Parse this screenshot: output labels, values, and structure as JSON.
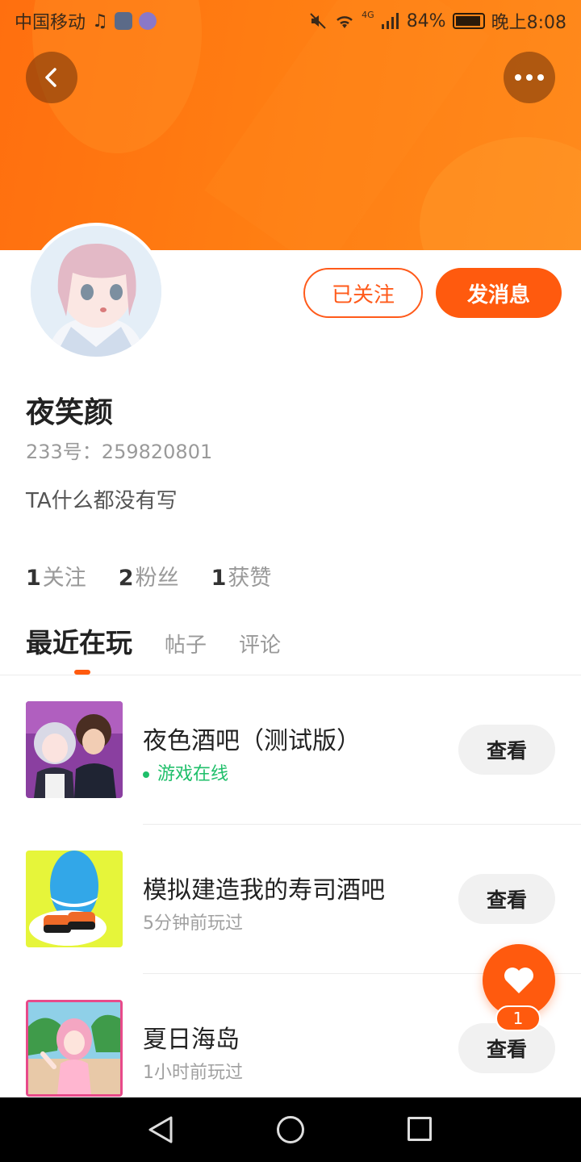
{
  "status_bar": {
    "carrier": "中国移动",
    "network": "4G",
    "battery": "84%",
    "time": "晚上8:08"
  },
  "header": {
    "back_icon": "chevron-left-icon",
    "more_icon": "more-horizontal-icon",
    "accent_color": "#ff6f0f"
  },
  "profile": {
    "follow_button_label": "已关注",
    "message_button_label": "发消息",
    "name": "夜笑颜",
    "id_line": "233号：259820801",
    "bio": "TA什么都没有写",
    "stats": [
      {
        "count": "1",
        "label": "关注"
      },
      {
        "count": "2",
        "label": "粉丝"
      },
      {
        "count": "1",
        "label": "获赞"
      }
    ]
  },
  "tabs": [
    {
      "label": "最近在玩",
      "active": true
    },
    {
      "label": "帖子",
      "active": false
    },
    {
      "label": "评论",
      "active": false
    }
  ],
  "games": [
    {
      "name": "夜色酒吧（测试版）",
      "status": "游戏在线",
      "online": true,
      "view_label": "查看"
    },
    {
      "name": "模拟建造我的寿司酒吧",
      "status": "5分钟前玩过",
      "online": false,
      "view_label": "查看"
    },
    {
      "name": "夏日海岛",
      "status": "1小时前玩过",
      "online": false,
      "view_label": "查看"
    }
  ],
  "fab": {
    "icon": "heart-icon",
    "badge": "1"
  }
}
